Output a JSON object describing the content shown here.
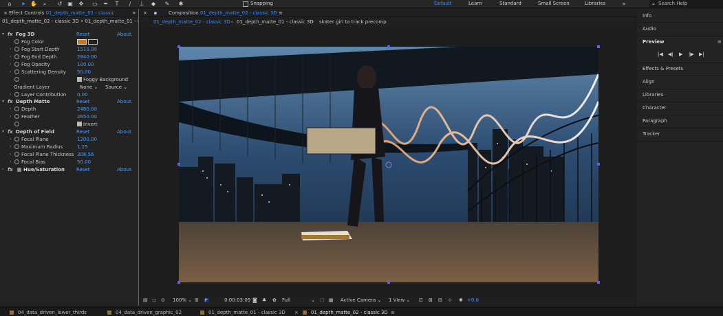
{
  "toolbar": {
    "icons": [
      "home-icon",
      "selection-icon",
      "hand-icon",
      "zoom-icon",
      "rotate-icon",
      "camera-icon",
      "pan-behind-icon",
      "mask-icon",
      "pen-icon",
      "type-icon",
      "brush-icon",
      "clone-icon",
      "eraser-icon",
      "roto-icon",
      "puppet-icon"
    ],
    "snapping_label": "Snapping",
    "workspaces": [
      "Default",
      "Learn",
      "Standard",
      "Small Screen",
      "Libraries"
    ],
    "search_placeholder": "Search Help",
    "accent": "#3d8cf5"
  },
  "effect_controls": {
    "tab_prefix": "Effect Controls",
    "tab_layer": "01_depth_matte_01 - classic",
    "header_path": "01_depth_matte_02 - classic 3D • 01_depth_matte_01 - classic",
    "reset_label": "Reset",
    "about_label": "About.",
    "effects": {
      "fog3d": {
        "name": "Fog 3D",
        "params": [
          {
            "label": "Fog Color",
            "value": ""
          },
          {
            "label": "Fog Start Depth",
            "value": "1510.00"
          },
          {
            "label": "Fog End Depth",
            "value": "2840.00"
          },
          {
            "label": "Fog Opacity",
            "value": "100.00"
          },
          {
            "label": "Scattering Density",
            "value": "50.00"
          },
          {
            "label": "",
            "value": ""
          },
          {
            "label": "Gradient Layer",
            "value": ""
          },
          {
            "label": "Layer Contribution",
            "value": "0.00"
          }
        ],
        "foggy_bg": "Foggy Background",
        "gradient_none": "None",
        "gradient_source": "Source"
      },
      "depth_matte": {
        "name": "Depth Matte",
        "params": [
          {
            "label": "Depth",
            "value": "2480.00"
          },
          {
            "label": "Feather",
            "value": "2650.00"
          }
        ],
        "invert": "Invert"
      },
      "dof": {
        "name": "Depth of Field",
        "params": [
          {
            "label": "Focal Plane",
            "value": "1200.00"
          },
          {
            "label": "Maximum Radius",
            "value": "1.25"
          },
          {
            "label": "Focal Plane Thickness",
            "value": "308.56"
          },
          {
            "label": "Focal Bias",
            "value": "50.00"
          }
        ]
      },
      "hue": {
        "name": "Hue/Saturation"
      }
    },
    "fog_color": "#d0781b"
  },
  "composition": {
    "tab_prefix": "Composition",
    "tab_comp": "01_depth_matte_02 - classic 3D",
    "breadcrumbs": [
      "01_depth_matte_02 - classic 3D",
      "01_depth_matte_01 - classic 3D",
      "skater girl to track precomp"
    ],
    "footer": {
      "zoom": "100%",
      "timecode": "0:00:03:09",
      "resolution": "Full",
      "camera": "Active Camera",
      "views": "1 View",
      "exposure": "+0.0"
    }
  },
  "right_panel": {
    "items_top": [
      "Info",
      "Audio"
    ],
    "preview_label": "Preview",
    "preview_controls": [
      "first-frame-icon",
      "prev-frame-icon",
      "play-icon",
      "next-frame-icon",
      "last-frame-icon"
    ],
    "items_bottom": [
      "Effects & Presets",
      "Align",
      "Libraries",
      "Character",
      "Paragraph",
      "Tracker"
    ]
  },
  "timeline_tabs": [
    "04_data_driven_lower_thirds",
    "04_data_driven_graphic_02",
    "01_depth_matte_01 - classic 3D",
    "01_depth_matte_02 - classic 3D"
  ]
}
